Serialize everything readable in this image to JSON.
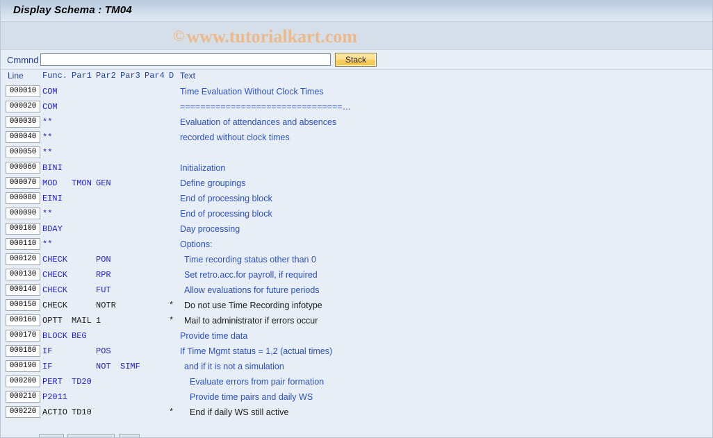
{
  "window": {
    "title": "Display Schema : TM04"
  },
  "watermark": {
    "symbol": "©",
    "text": "www.tutorialkart.com"
  },
  "command_bar": {
    "label": "Cmmnd",
    "input_value": "",
    "input_placeholder": "",
    "stack_button": "Stack"
  },
  "table": {
    "headers": {
      "line": "Line",
      "func": "Func.",
      "par1": "Par1",
      "par2": "Par2",
      "par3": "Par3",
      "par4": "Par4",
      "d": "D",
      "text": "Text"
    },
    "rows": [
      {
        "line": "000010",
        "func": "COM",
        "par1": "",
        "par2": "",
        "par3": "",
        "par4": "",
        "d": "",
        "text": "Time Evaluation Without Clock Times",
        "indent": 0,
        "inactive": false
      },
      {
        "line": "000020",
        "func": "COM",
        "par1": "",
        "par2": "",
        "par3": "",
        "par4": "",
        "d": "",
        "text": "================================…",
        "indent": 0,
        "inactive": false
      },
      {
        "line": "000030",
        "func": "**",
        "par1": "",
        "par2": "",
        "par3": "",
        "par4": "",
        "d": "",
        "text": "Evaluation of attendances and absences",
        "indent": 0,
        "inactive": false
      },
      {
        "line": "000040",
        "func": "**",
        "par1": "",
        "par2": "",
        "par3": "",
        "par4": "",
        "d": "",
        "text": "recorded without clock times",
        "indent": 0,
        "inactive": false
      },
      {
        "line": "000050",
        "func": "**",
        "par1": "",
        "par2": "",
        "par3": "",
        "par4": "",
        "d": "",
        "text": "",
        "indent": 0,
        "inactive": false
      },
      {
        "line": "000060",
        "func": "BINI",
        "par1": "",
        "par2": "",
        "par3": "",
        "par4": "",
        "d": "",
        "text": "Initialization",
        "indent": 0,
        "inactive": false
      },
      {
        "line": "000070",
        "func": "MOD",
        "par1": "TMON",
        "par2": "GEN",
        "par3": "",
        "par4": "",
        "d": "",
        "text": "Define groupings",
        "indent": 0,
        "inactive": false
      },
      {
        "line": "000080",
        "func": "EINI",
        "par1": "",
        "par2": "",
        "par3": "",
        "par4": "",
        "d": "",
        "text": "End of processing block",
        "indent": 0,
        "inactive": false
      },
      {
        "line": "000090",
        "func": "**",
        "par1": "",
        "par2": "",
        "par3": "",
        "par4": "",
        "d": "",
        "text": "End of processing block",
        "indent": 0,
        "inactive": false
      },
      {
        "line": "000100",
        "func": "BDAY",
        "par1": "",
        "par2": "",
        "par3": "",
        "par4": "",
        "d": "",
        "text": "Day processing",
        "indent": 0,
        "inactive": false
      },
      {
        "line": "000110",
        "func": "**",
        "par1": "",
        "par2": "",
        "par3": "",
        "par4": "",
        "d": "",
        "text": "Options:",
        "indent": 0,
        "inactive": false
      },
      {
        "line": "000120",
        "func": "CHECK",
        "par1": "",
        "par2": "PON",
        "par3": "",
        "par4": "",
        "d": "",
        "text": "Time recording status other than 0",
        "indent": 1,
        "inactive": false
      },
      {
        "line": "000130",
        "func": "CHECK",
        "par1": "",
        "par2": "RPR",
        "par3": "",
        "par4": "",
        "d": "",
        "text": "Set retro.acc.for payroll, if required",
        "indent": 1,
        "inactive": false
      },
      {
        "line": "000140",
        "func": "CHECK",
        "par1": "",
        "par2": "FUT",
        "par3": "",
        "par4": "",
        "d": "",
        "text": "Allow evaluations for future periods",
        "indent": 1,
        "inactive": false
      },
      {
        "line": "000150",
        "func": "CHECK",
        "par1": "",
        "par2": "NOTR",
        "par3": "",
        "par4": "",
        "d": "*",
        "text": "Do not use Time Recording infotype",
        "indent": 1,
        "inactive": true
      },
      {
        "line": "000160",
        "func": "OPTT",
        "par1": "MAIL",
        "par2": "1",
        "par3": "",
        "par4": "",
        "d": "*",
        "text": "Mail to administrator if errors occur",
        "indent": 1,
        "inactive": true
      },
      {
        "line": "000170",
        "func": "BLOCK",
        "par1": "BEG",
        "par2": "",
        "par3": "",
        "par4": "",
        "d": "",
        "text": "Provide time data",
        "indent": 0,
        "inactive": false
      },
      {
        "line": "000180",
        "func": "IF",
        "par1": "",
        "par2": "POS",
        "par3": "",
        "par4": "",
        "d": "",
        "text": "If Time Mgmt status = 1,2 (actual times)",
        "indent": 0,
        "inactive": false
      },
      {
        "line": "000190",
        "func": "IF",
        "par1": "",
        "par2": "NOT",
        "par3": "SIMF",
        "par4": "",
        "d": "",
        "text": "and if it is not a simulation",
        "indent": 1,
        "inactive": false
      },
      {
        "line": "000200",
        "func": "PERT",
        "par1": "TD20",
        "par2": "",
        "par3": "",
        "par4": "",
        "d": "",
        "text": "Evaluate errors from pair formation",
        "indent": 2,
        "inactive": false
      },
      {
        "line": "000210",
        "func": "P2011",
        "par1": "",
        "par2": "",
        "par3": "",
        "par4": "",
        "d": "",
        "text": "Provide time pairs and daily WS",
        "indent": 2,
        "inactive": false
      },
      {
        "line": "000220",
        "func": "ACTIO",
        "par1": "TD10",
        "par2": "",
        "par3": "",
        "par4": "",
        "d": "*",
        "text": "End if daily WS still active",
        "indent": 2,
        "inactive": true
      }
    ]
  },
  "colors": {
    "background": "#e8eef5",
    "title_gradient_top": "#b9cbe0",
    "code_blue": "#2222dd",
    "text_blue": "#2b4fc8",
    "label_blue": "#21409a",
    "stack_yellow": "#f3c44c",
    "watermark_orange": "#edb98a"
  }
}
